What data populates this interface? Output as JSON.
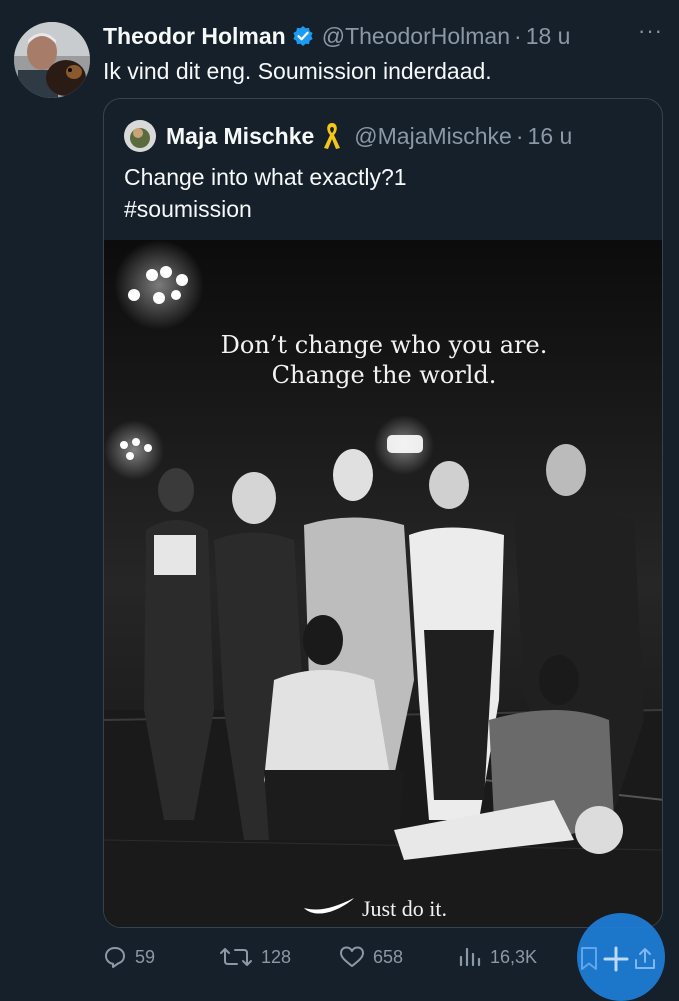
{
  "tweet": {
    "author_name": "Theodor Holman",
    "handle": "@TheodorHolman",
    "separator": "·",
    "time": "18 u",
    "text": "Ik vind dit eng. Soumission inderdaad.",
    "more_label": "···"
  },
  "quote": {
    "author_name": "Maja Mischke",
    "handle": "@MajaMischke",
    "separator": "·",
    "time": "16 u",
    "text_line1": "Change into what exactly?1",
    "text_line2": "#soumission",
    "media": {
      "headline_line1": "Don’t change who you are.",
      "headline_line2": "Change the world.",
      "tagline": "Just do it."
    }
  },
  "actions": {
    "replies": "59",
    "reposts": "128",
    "likes": "658",
    "views": "16,3K"
  },
  "colors": {
    "background": "#15202b",
    "muted": "#8b98a5",
    "verified": "#1d9bf0",
    "ribbon": "#f5c518",
    "fab": "#1d7ed8"
  }
}
